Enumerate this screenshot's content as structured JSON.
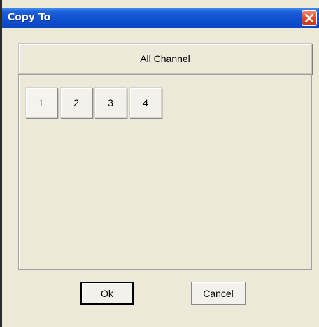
{
  "window": {
    "title": "Copy To",
    "titlebar_color": "#0f4fcf",
    "close_icon": "close-icon",
    "close_color": "#e0492b"
  },
  "channel_header": {
    "label": "All Channel"
  },
  "channels": [
    {
      "label": "1",
      "enabled": false
    },
    {
      "label": "2",
      "enabled": true
    },
    {
      "label": "3",
      "enabled": true
    },
    {
      "label": "4",
      "enabled": true
    }
  ],
  "buttons": {
    "ok_label": "Ok",
    "cancel_label": "Cancel"
  }
}
